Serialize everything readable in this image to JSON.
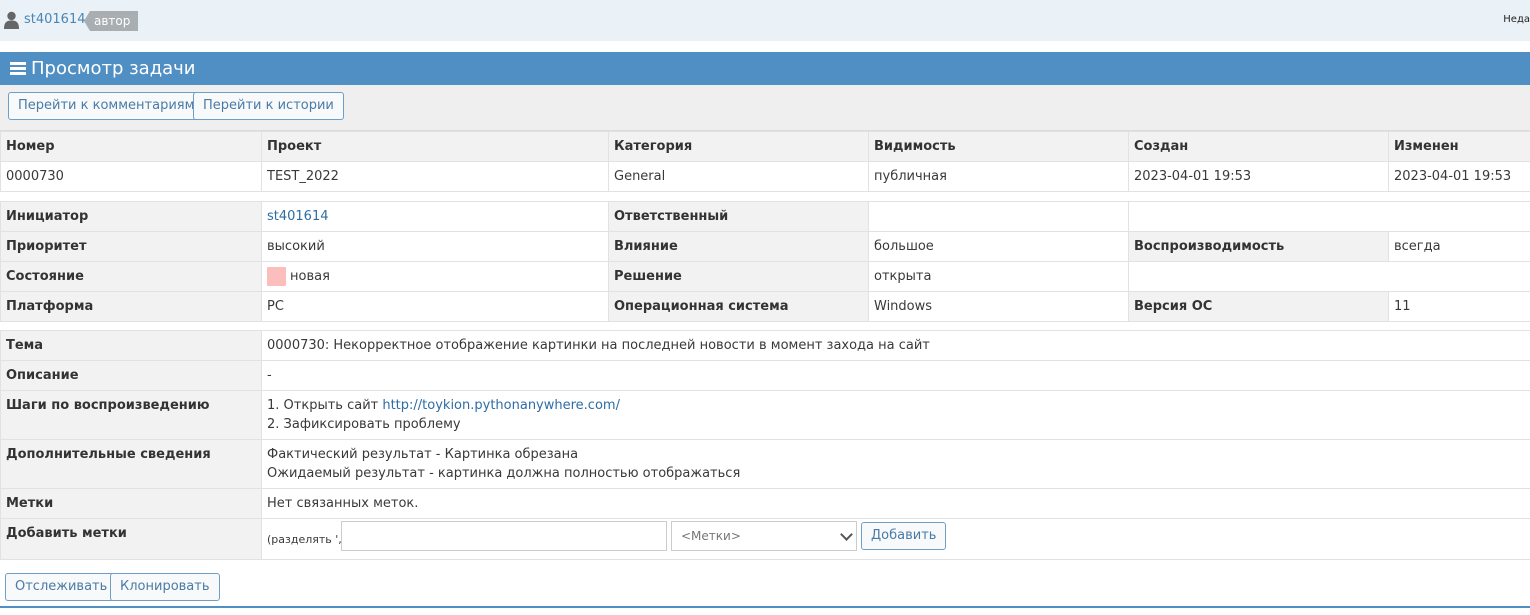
{
  "user": {
    "name": "st401614",
    "role": "автор",
    "right_text": "Неда"
  },
  "header": {
    "title": "Просмотр задачи"
  },
  "toolbar": {
    "comments_btn": "Перейти к комментариям",
    "history_btn": "Перейти к истории"
  },
  "summary": {
    "headers": [
      "Номер",
      "Проект",
      "Категория",
      "Видимость",
      "Создан",
      "Изменен"
    ],
    "values": [
      "0000730",
      "TEST_2022",
      "General",
      "публичная",
      "2023-04-01 19:53",
      "2023-04-01 19:53"
    ]
  },
  "details": {
    "reporter_label": "Инициатор",
    "reporter": "st401614",
    "handler_label": "Ответственный",
    "handler": "",
    "priority_label": "Приоритет",
    "priority": "высокий",
    "severity_label": "Влияние",
    "severity": "большое",
    "reproducibility_label": "Воспроизводимость",
    "reproducibility": "всегда",
    "status_label": "Состояние",
    "status": "новая",
    "status_color": "#fcbdbd",
    "resolution_label": "Решение",
    "resolution": "открыта",
    "platform_label": "Платформа",
    "platform": "PC",
    "os_label": "Операционная система",
    "os": "Windows",
    "os_version_label": "Версия ОС",
    "os_version": "11"
  },
  "text_fields": {
    "summary_label": "Тема",
    "summary": "0000730: Некорректное отображение картинки на последней новости в момент захода на сайт",
    "description_label": "Описание",
    "description": "-",
    "steps_label": "Шаги по воспроизведению",
    "steps_line1_prefix": "1. Открыть сайт ",
    "steps_link": "http://toykion.pythonanywhere.com/",
    "steps_line2": "2. Зафиксировать проблему",
    "additional_label": "Дополнительные сведения",
    "additional_line1": "Фактический результат - Картинка обрезана",
    "additional_line2": "Ожидаемый результат - картинка должна полностью отображаться",
    "tags_label": "Метки",
    "tags": "Нет связанных меток.",
    "add_tags_label": "Добавить метки",
    "add_tags_hint": "(разделять ',')",
    "tag_input_value": "",
    "tag_select_value": "<Метки>",
    "add_button": "Добавить"
  },
  "footer": {
    "monitor_btn": "Отслеживать",
    "clone_btn": "Клонировать"
  },
  "colors": {
    "header_bg": "#4f8fc4",
    "topbar_bg": "#eaf2f8",
    "link": "#2e6da4"
  }
}
